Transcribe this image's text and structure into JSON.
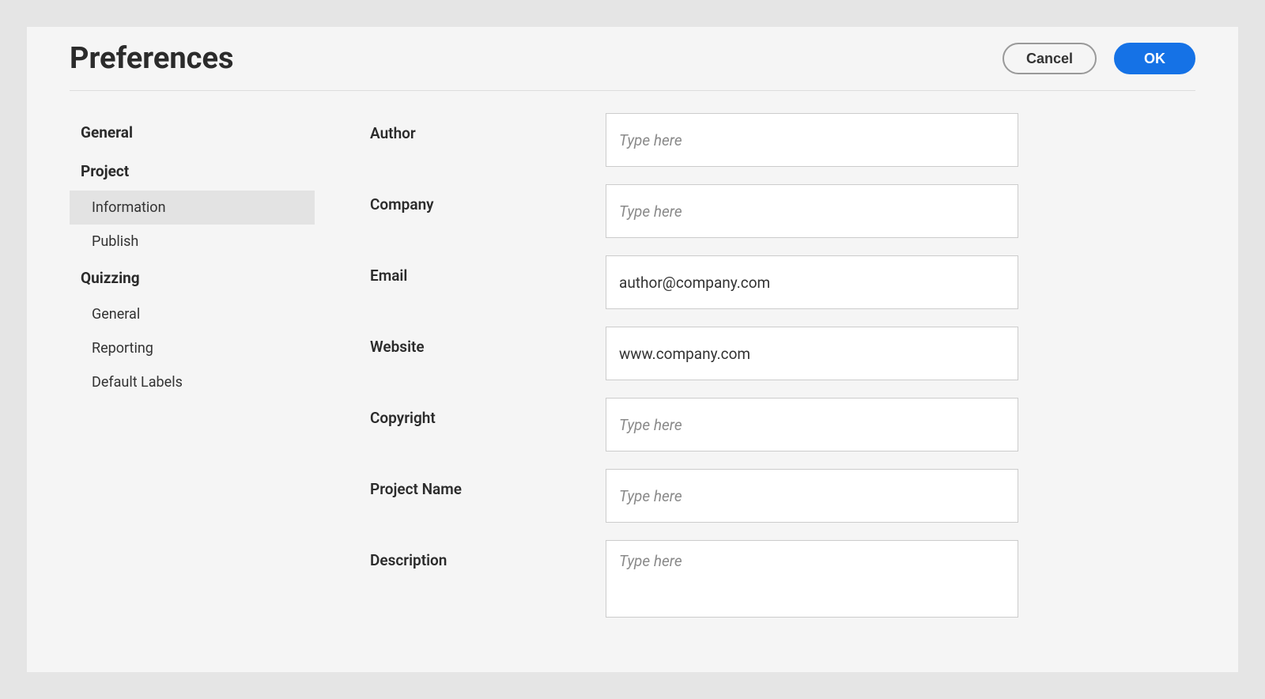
{
  "title": "Preferences",
  "buttons": {
    "cancel": "Cancel",
    "ok": "OK"
  },
  "sidebar": {
    "sections": [
      {
        "label": "General",
        "items": []
      },
      {
        "label": "Project",
        "items": [
          {
            "label": "Information",
            "selected": true
          },
          {
            "label": "Publish",
            "selected": false
          }
        ]
      },
      {
        "label": "Quizzing",
        "items": [
          {
            "label": "General",
            "selected": false
          },
          {
            "label": "Reporting",
            "selected": false
          },
          {
            "label": "Default Labels",
            "selected": false
          }
        ]
      }
    ]
  },
  "form": {
    "author": {
      "label": "Author",
      "value": "",
      "placeholder": "Type here"
    },
    "company": {
      "label": "Company",
      "value": "",
      "placeholder": "Type here"
    },
    "email": {
      "label": "Email",
      "value": "author@company.com",
      "placeholder": "Type here"
    },
    "website": {
      "label": "Website",
      "value": "www.company.com",
      "placeholder": "Type here"
    },
    "copyright": {
      "label": "Copyright",
      "value": "",
      "placeholder": "Type here"
    },
    "project_name": {
      "label": "Project Name",
      "value": "",
      "placeholder": "Type here"
    },
    "description": {
      "label": "Description",
      "value": "",
      "placeholder": "Type here"
    }
  }
}
